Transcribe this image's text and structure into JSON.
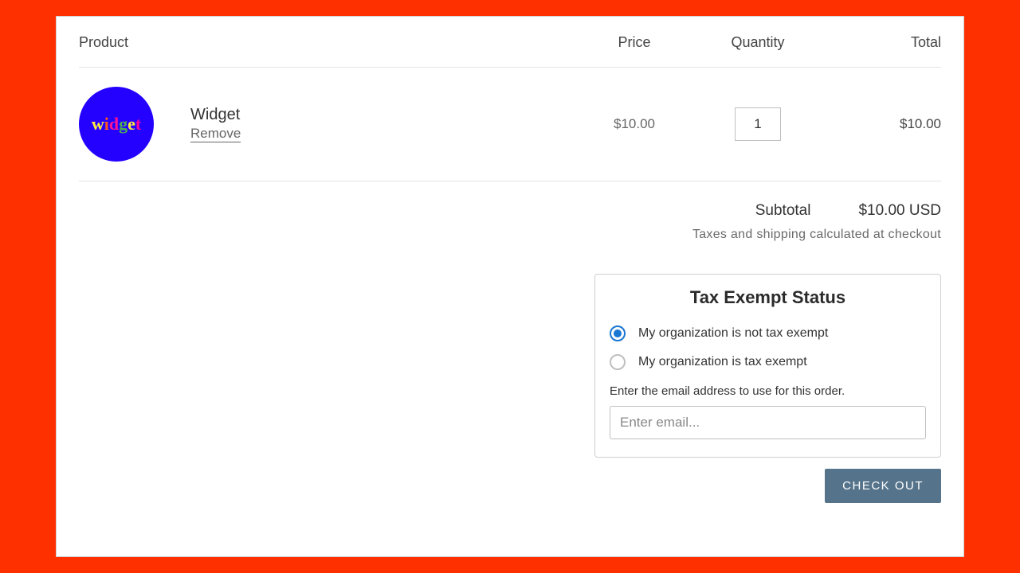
{
  "table": {
    "headers": {
      "product": "Product",
      "price": "Price",
      "quantity": "Quantity",
      "total": "Total"
    }
  },
  "item": {
    "name": "Widget",
    "remove_label": "Remove",
    "price": "$10.00",
    "quantity": "1",
    "total": "$10.00",
    "logo_text": "widget"
  },
  "summary": {
    "subtotal_label": "Subtotal",
    "subtotal_value": "$10.00 USD",
    "tax_note": "Taxes and shipping calculated at checkout"
  },
  "tax_exempt": {
    "title": "Tax Exempt Status",
    "opt_not_exempt": "My organization is not tax exempt",
    "opt_exempt": "My organization is tax exempt",
    "email_instruction": "Enter the email address to use for this order.",
    "email_placeholder": "Enter email..."
  },
  "checkout_label": "CHECK OUT"
}
